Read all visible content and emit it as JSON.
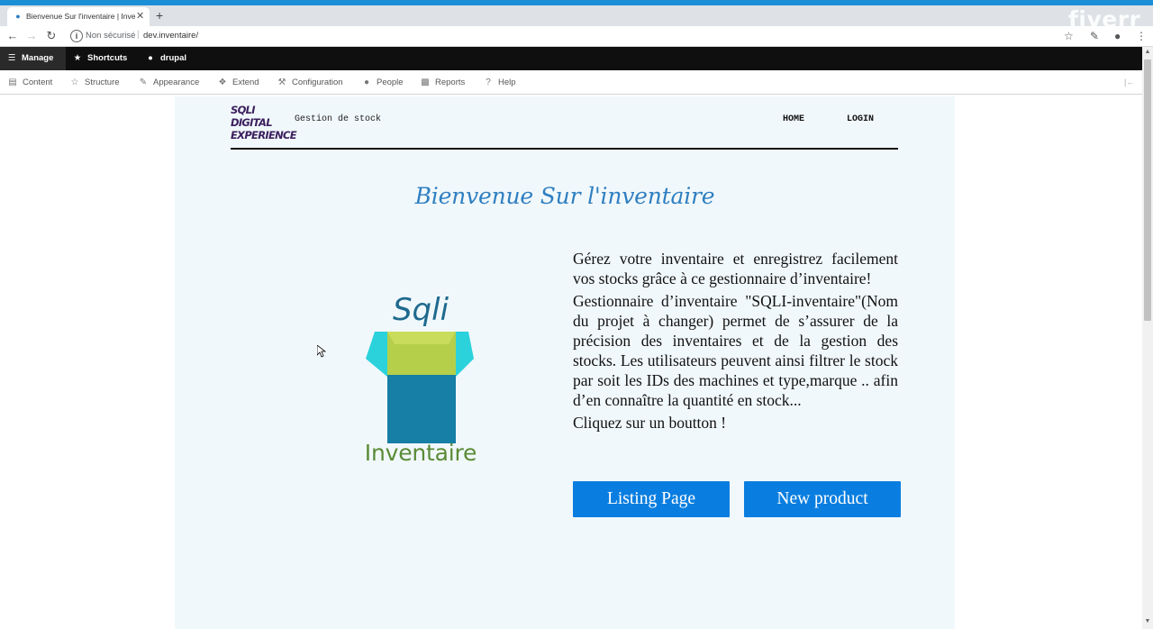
{
  "browser": {
    "tab_title": "Bienvenue Sur l'inventaire | Inve",
    "favicon": "drupal-drop-icon",
    "close_glyph": "✕",
    "newtab_glyph": "+",
    "watermark": "fiverr",
    "insecure_label": "Non sécurisé",
    "separator": "|",
    "url": "dev.inventaire/",
    "accent_color": "#1a8fd6"
  },
  "toolbar": {
    "manage": "Manage",
    "shortcuts": "Shortcuts",
    "user": "drupal"
  },
  "tray": {
    "items": [
      {
        "label": "Content",
        "icon": "content-icon"
      },
      {
        "label": "Structure",
        "icon": "structure-icon"
      },
      {
        "label": "Appearance",
        "icon": "appearance-icon"
      },
      {
        "label": "Extend",
        "icon": "extend-icon"
      },
      {
        "label": "Configuration",
        "icon": "configuration-icon"
      },
      {
        "label": "People",
        "icon": "people-icon"
      },
      {
        "label": "Reports",
        "icon": "reports-icon"
      },
      {
        "label": "Help",
        "icon": "help-icon"
      }
    ]
  },
  "header": {
    "logo_lines": [
      "SQLI",
      "DIGITAL",
      "EXPERIENCE"
    ],
    "slogan": "Gestion de stock",
    "nav": [
      "HOME",
      "LOGIN"
    ]
  },
  "main": {
    "title": "Bienvenue Sur l'inventaire",
    "logo_top": "Sqli",
    "logo_bottom": "Inventaire",
    "paragraph1": "Gérez votre inventaire et enregistrez facilement vos stocks grâce à ce gestionnaire d’inventaire!",
    "paragraph2": "Gestionnaire d’inventaire \"SQLI-inventaire\"(Nom du projet à changer) permet de s’assurer de la précision des inventaires et de la gestion des stocks. Les utilisateurs peuvent ainsi filtrer le stock par soit les IDs des machines et type,marque .. afin d’en connaître la quantité en stock...",
    "paragraph3": "Cliquez sur un boutton !",
    "buttons": [
      "Listing Page",
      "New product"
    ],
    "button_color": "#0a7ee0",
    "background": "#f1f8fb"
  }
}
